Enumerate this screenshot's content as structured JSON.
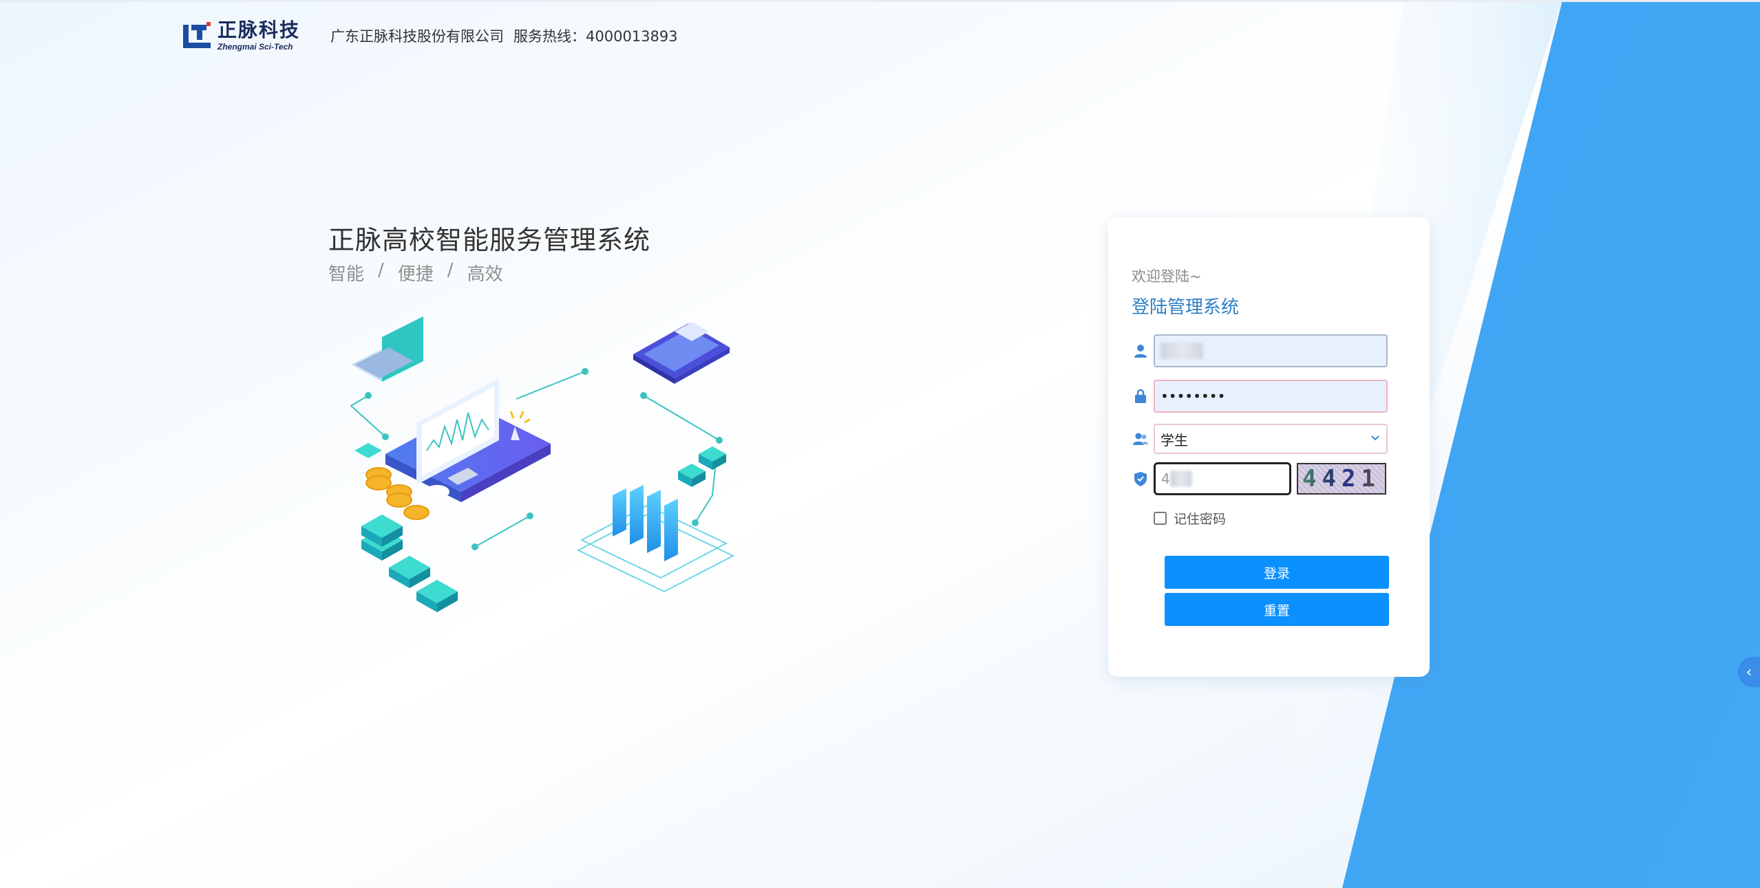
{
  "header": {
    "logo_cn": "正脉科技",
    "logo_en": "Zhengmai Sci-Tech",
    "company": "广东正脉科技股份有限公司",
    "hotline": "服务热线：4000013893"
  },
  "hero": {
    "title": "正脉高校智能服务管理系统",
    "tag1": "智能",
    "tag2": "便捷",
    "tag3": "高效",
    "separator": "/"
  },
  "login": {
    "welcome": "欢迎登陆~",
    "title": "登陆管理系统",
    "password_mask": "••••••••",
    "role_value": "学生",
    "captcha_prefix": "4",
    "captcha_code": "4421",
    "remember_label": "记住密码",
    "login_button": "登录",
    "reset_button": "重置"
  },
  "colors": {
    "accent_blue": "#0b90ff",
    "title_blue": "#2d7fc5",
    "right_panel_blue": "#3da2f5"
  },
  "icons": {
    "user": "user-icon",
    "lock": "lock-icon",
    "role": "users-icon",
    "shield": "shield-check-icon",
    "chevron": "chevron-down-icon",
    "side_tab": "chevron-left-icon"
  }
}
